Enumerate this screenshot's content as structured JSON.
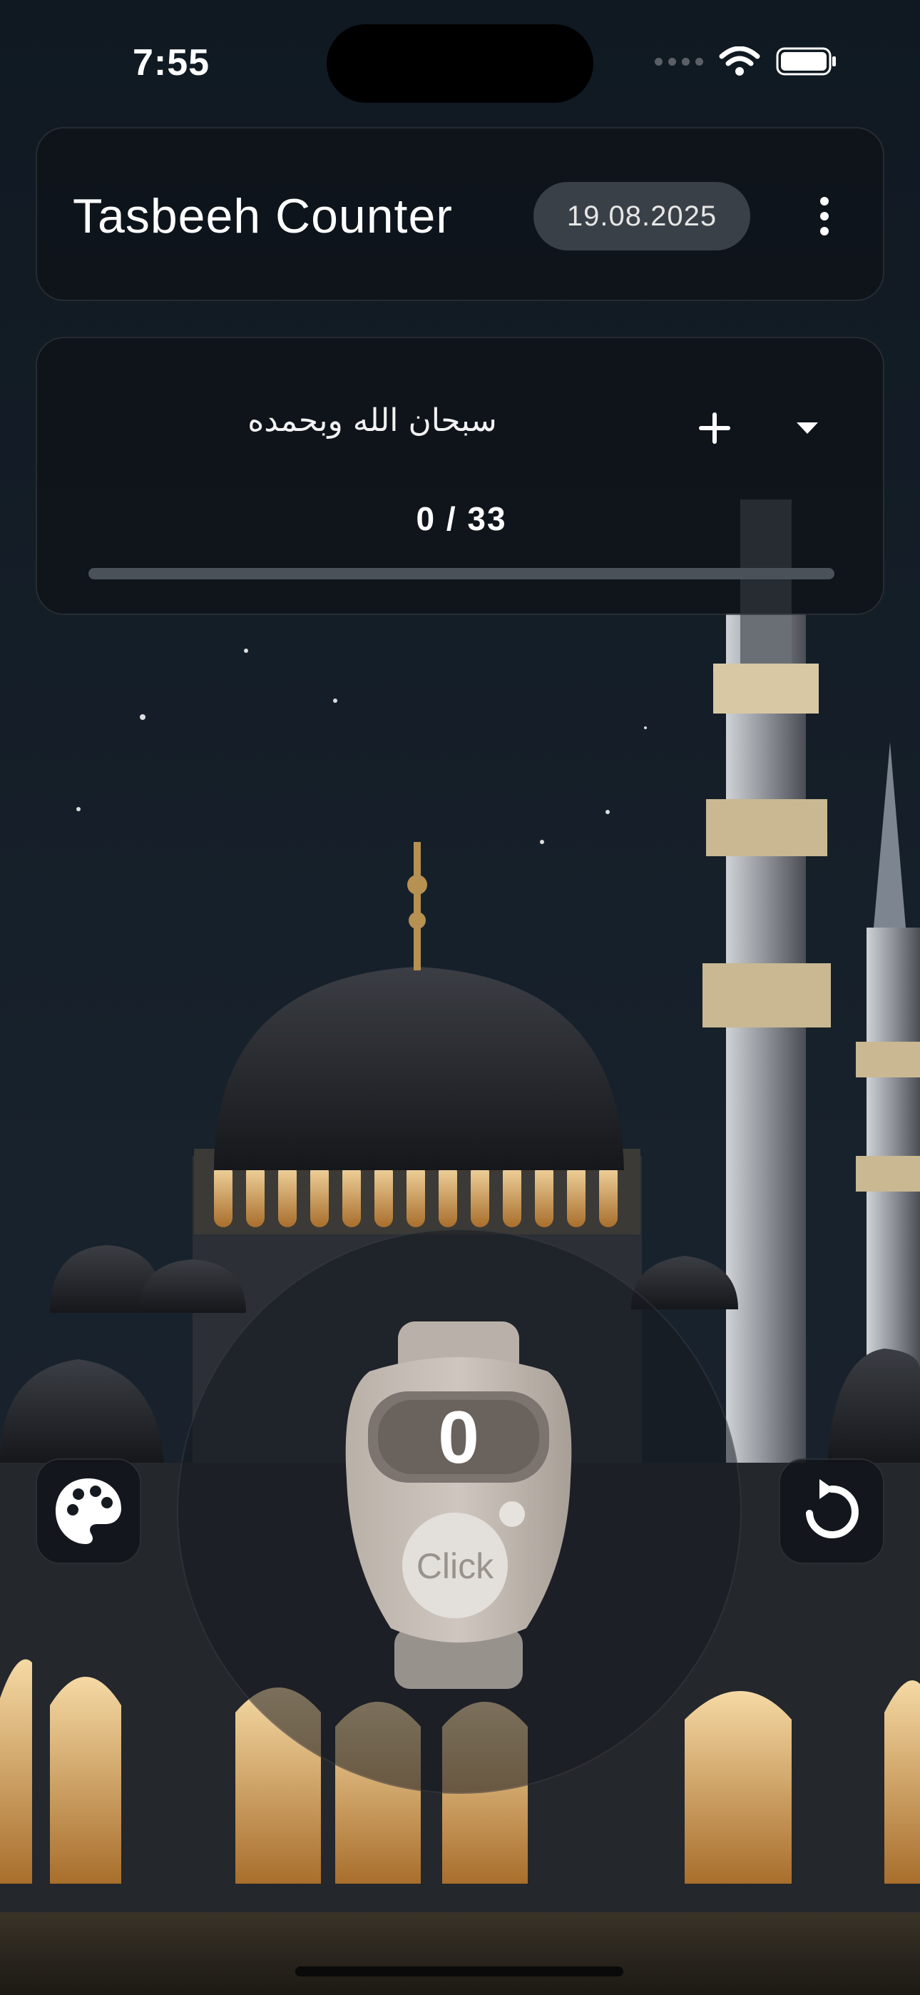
{
  "status_bar": {
    "time": "7:55",
    "wifi_icon": "wifi-icon",
    "battery_icon": "battery-icon"
  },
  "header": {
    "title": "Tasbeeh Counter",
    "date": "19.08.2025",
    "menu_icon": "more-vertical-icon"
  },
  "dhikr": {
    "text": "سبحان الله وبحمده",
    "add_icon": "plus-icon",
    "dropdown_icon": "caret-down-icon",
    "progress_text": "0 / 33",
    "current": 0,
    "target": 33,
    "progress_fraction": 0
  },
  "counter": {
    "count": "0",
    "button_label": "Click"
  },
  "actions": {
    "theme_icon": "palette-icon",
    "reset_icon": "reset-icon"
  },
  "colors": {
    "background": "#0b1118",
    "card": "#0e1218",
    "badge": "#3a4048",
    "accent_gold": "#c9a35a",
    "progress_track": "#4b5158"
  }
}
